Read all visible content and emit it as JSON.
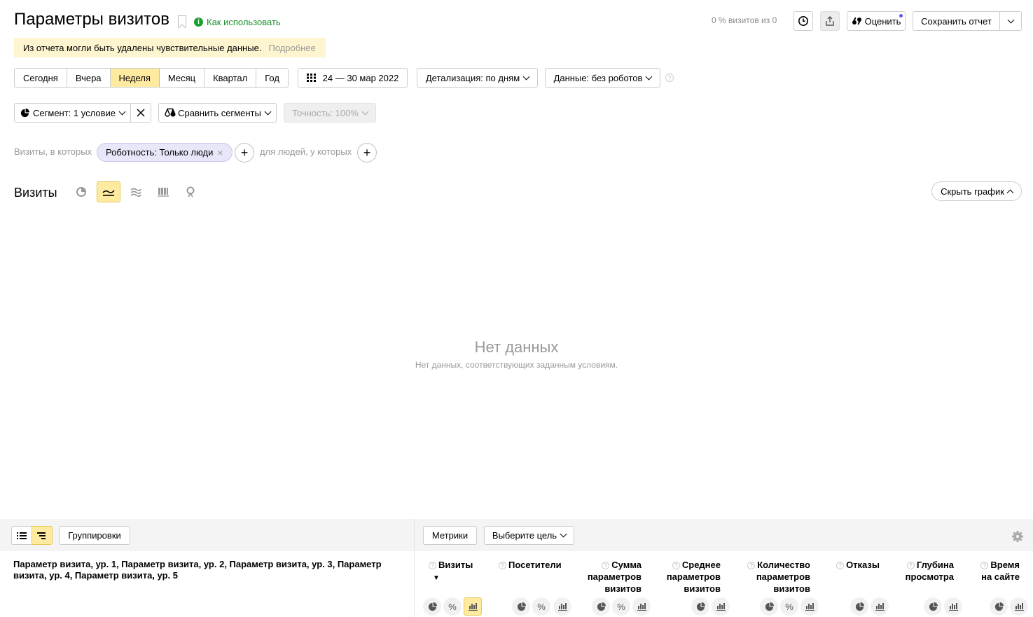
{
  "header": {
    "title": "Параметры визитов",
    "howto": "Как использовать",
    "visits_share": "0 % визитов из 0",
    "rate_label": "Оценить",
    "save_label": "Сохранить отчет"
  },
  "warning": {
    "text": "Из отчета могли быть удалены чувствительные данные.",
    "more": "Подробнее"
  },
  "periods": [
    "Сегодня",
    "Вчера",
    "Неделя",
    "Месяц",
    "Квартал",
    "Год"
  ],
  "date_range": "24 — 30 мар 2022",
  "detail_label": "Детализация: по дням",
  "data_label": "Данные: без роботов",
  "segment": {
    "label": "Сегмент: 1 условие",
    "compare": "Сравнить сегменты",
    "accuracy": "Точность: 100%"
  },
  "filters": {
    "visits_where": "Визиты, в которых",
    "chip": "Роботность: Только люди",
    "people_where": "для людей, у которых"
  },
  "chart": {
    "title": "Визиты",
    "hide_label": "Скрыть график",
    "nodata_title": "Нет данных",
    "nodata_sub": "Нет данных, соответствующих заданным условиям."
  },
  "table": {
    "groupings_label": "Группировки",
    "metrics_label": "Метрики",
    "goal_label": "Выберите цель",
    "dimensions": "Параметр визита, ур. 1, Параметр визита, ур. 2, Параметр визита, ур. 3, Параметр визита, ур. 4, Параметр визита, ур. 5",
    "columns": [
      {
        "l1": "Визиты",
        "l2": "",
        "l3": ""
      },
      {
        "l1": "Посетители",
        "l2": "",
        "l3": ""
      },
      {
        "l1": "Сумма",
        "l2": "параметров",
        "l3": "визитов"
      },
      {
        "l1": "Среднее",
        "l2": "параметров",
        "l3": "визитов"
      },
      {
        "l1": "Количество",
        "l2": "параметров",
        "l3": "визитов"
      },
      {
        "l1": "Отказы",
        "l2": "",
        "l3": ""
      },
      {
        "l1": "Глубина",
        "l2": "просмотра",
        "l3": ""
      },
      {
        "l1": "Время",
        "l2": "на сайте",
        "l3": ""
      }
    ],
    "sort_mark": "▼"
  },
  "colors": {
    "accent": "#ffeba0",
    "link_green": "#1a8f2c",
    "warning_bg": "#fdf4d0",
    "chip_bg": "#e8e6f9"
  }
}
